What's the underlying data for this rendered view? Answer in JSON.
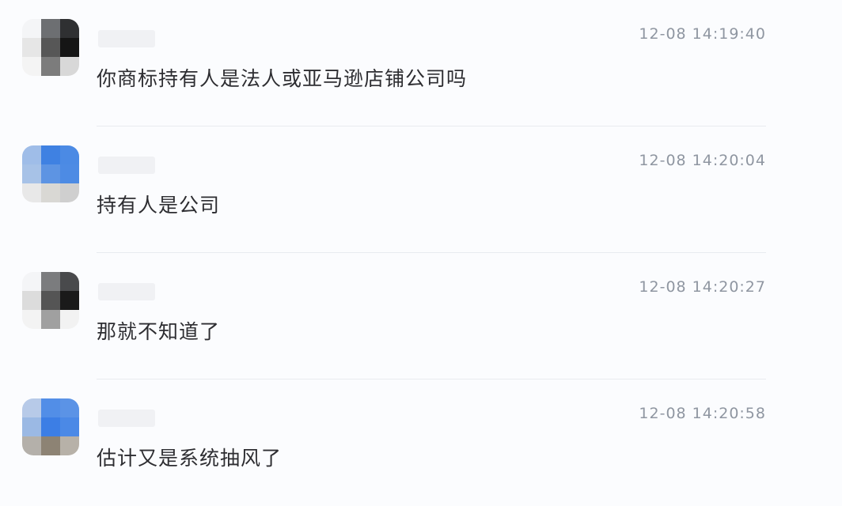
{
  "messages": [
    {
      "time": "12-08 14:19:40",
      "text": "你商标持有人是法人或亚马逊店铺公司吗",
      "avatar_palette": [
        "#f4f5f7",
        "#6d6f72",
        "#2f3032",
        "#e6e6e6",
        "#575757",
        "#151515",
        "#f4f4f4",
        "#7c7c7c",
        "#d8d8d8"
      ]
    },
    {
      "time": "12-08 14:20:04",
      "text": "持有人是公司",
      "avatar_palette": [
        "#9fbde8",
        "#3f81e2",
        "#4b8ae4",
        "#a7c2e7",
        "#5d94e3",
        "#4d8be4",
        "#e8e8e8",
        "#d9d8d4",
        "#cfcfcf"
      ]
    },
    {
      "time": "12-08 14:20:27",
      "text": "那就不知道了",
      "avatar_palette": [
        "#f4f5f7",
        "#7b7c7e",
        "#494a4c",
        "#dcdcdc",
        "#555555",
        "#1a1a1a",
        "#f3f3f3",
        "#a0a0a0",
        "#f2f2f2"
      ]
    },
    {
      "time": "12-08 14:20:58",
      "text": "估计又是系统抽风了",
      "avatar_palette": [
        "#b7cae8",
        "#528ee7",
        "#5b93e6",
        "#9bb9e4",
        "#3c7ee5",
        "#4b89e6",
        "#b4b0aa",
        "#8d8374",
        "#b7b1a8"
      ]
    }
  ]
}
